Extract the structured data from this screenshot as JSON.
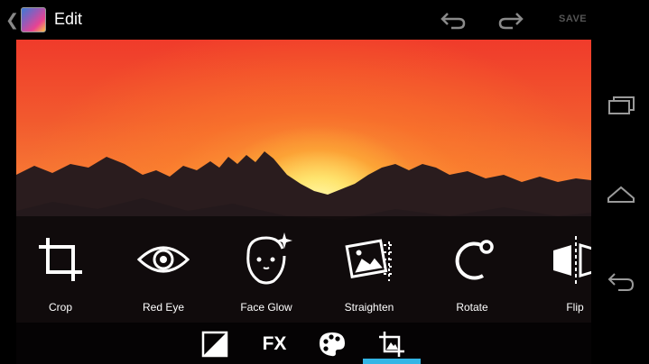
{
  "action_bar": {
    "title": "Edit",
    "save_label": "SAVE"
  },
  "tools": [
    {
      "label": "Crop",
      "icon": "crop-icon"
    },
    {
      "label": "Red Eye",
      "icon": "eye-icon"
    },
    {
      "label": "Face Glow",
      "icon": "face-sparkle-icon"
    },
    {
      "label": "Straighten",
      "icon": "straighten-icon"
    },
    {
      "label": "Rotate",
      "icon": "rotate-icon"
    },
    {
      "label": "Flip",
      "icon": "flip-icon"
    }
  ],
  "bottom_tabs": [
    {
      "name": "exposure",
      "icon": "exposure-icon"
    },
    {
      "name": "fx",
      "label": "FX"
    },
    {
      "name": "color",
      "icon": "palette-icon"
    },
    {
      "name": "crop-tools",
      "icon": "crop-photo-icon",
      "selected": true
    }
  ],
  "colors": {
    "accent": "#33b5e5",
    "sky_top": "#f03b2b",
    "sky_glow": "#fff5b0"
  }
}
